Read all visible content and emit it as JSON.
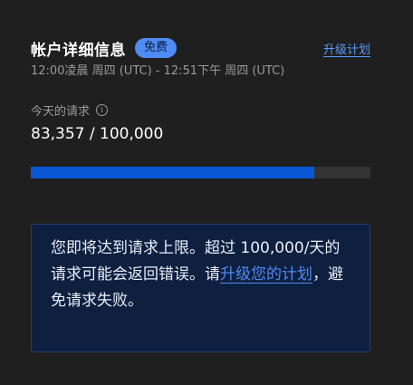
{
  "account": {
    "title": "帐户详细信息",
    "plan_badge": "免费",
    "upgrade_link": "升级计划",
    "time_range": "12:00凌晨 周四 (UTC) - 12:51下午 周四 (UTC)"
  },
  "requests": {
    "label": "今天的请求",
    "info_icon": "info-icon",
    "count_text": "83,357 / 100,000",
    "used": 83357,
    "limit": 100000,
    "progress_fraction": 0.834
  },
  "alert": {
    "text_before": "您即将达到请求上限。超过 100,000/天的请求可能会返回错误。请",
    "link_text": "升级您的计划",
    "text_after": "，避免请求失败。"
  },
  "colors": {
    "background": "#1f1f1f",
    "accent": "#4f8bf5",
    "progress_fill": "#0a57d4",
    "alert_background": "#0e1f3f"
  }
}
